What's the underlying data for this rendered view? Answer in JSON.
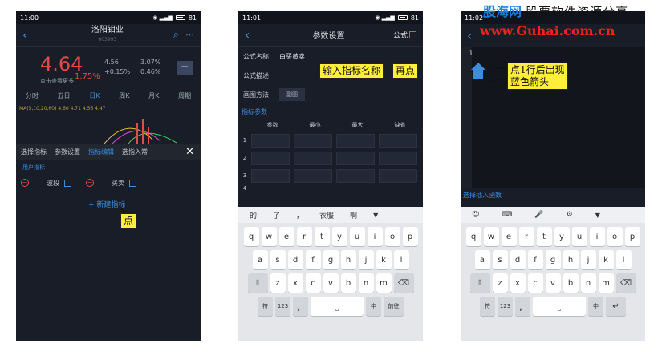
{
  "phone1": {
    "status": {
      "time": "11:00",
      "battery": "81"
    },
    "title": "洛阳钼业",
    "code": "603993",
    "price": "4.64",
    "change": "1.75%",
    "detail_link": "点击查看更多",
    "stats": [
      "4.56",
      "+0.15%"
    ],
    "stats2": [
      "3.07%",
      "0.46%"
    ],
    "tabs": [
      "分时",
      "五日",
      "日K",
      "周K",
      "月K",
      "周期"
    ],
    "ma_line": "MA(5,10,20,60)  4.60  4.71  4.56  4.47",
    "menu": [
      "选择指标",
      "参数设置",
      "指标编辑",
      "选指入常"
    ],
    "user_label": "用户指标",
    "indicators": [
      "波段",
      "买卖"
    ],
    "new_indicator": "+ 新建指标",
    "callout": "点"
  },
  "phone2": {
    "status": {
      "time": "11:01",
      "battery": "81"
    },
    "title": "参数设置",
    "right_label": "公式",
    "formula_name_label": "公式名称",
    "formula_name_value": "白买黄卖",
    "formula_desc_label": "公式描述",
    "draw_label": "画图方法",
    "draw_button": "副图",
    "params_section": "指标参数",
    "param_headers": [
      "参数",
      "最小",
      "最大",
      "缺省"
    ],
    "row_numbers": [
      "1",
      "2",
      "3",
      "4"
    ],
    "callout_name": "输入指标名称",
    "callout_click": "再点",
    "candidates": [
      "的",
      "了",
      "，",
      "衣服",
      "啊"
    ]
  },
  "phone3": {
    "status": {
      "time": "11:02"
    },
    "line_number": "1",
    "callout": "点1行后出现\n蓝色箭头",
    "insert_label": "选择插入函数"
  },
  "keyboard": {
    "row1": [
      "q",
      "w",
      "e",
      "r",
      "t",
      "y",
      "u",
      "i",
      "o",
      "p"
    ],
    "row2": [
      "a",
      "s",
      "d",
      "f",
      "g",
      "h",
      "j",
      "k",
      "l"
    ],
    "row3": [
      "z",
      "x",
      "c",
      "v",
      "b",
      "n",
      "m"
    ],
    "bottom2": [
      "符",
      "123",
      "，",
      "中",
      "前往"
    ],
    "bottom3": [
      "符",
      "123",
      "，",
      "中"
    ]
  },
  "watermark": {
    "cn1": "股海网",
    "cn2": "股票软件资源分享",
    "url": "www.Guhai.com.cn"
  }
}
